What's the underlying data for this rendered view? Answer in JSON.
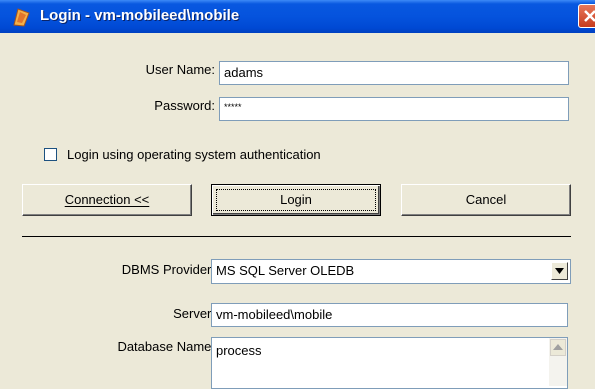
{
  "window": {
    "title": "Login - vm-mobileed\\mobile"
  },
  "login": {
    "username_label": "User Name:",
    "username_value": "adams",
    "password_label": "Password:",
    "password_value": "*****",
    "os_auth_label": "Login using operating system authentication",
    "os_auth_checked": false
  },
  "buttons": {
    "connection_label": "Connection <<",
    "login_label": "Login",
    "cancel_label": "Cancel"
  },
  "connection": {
    "provider_label": "DBMS Provider:",
    "provider_value": "MS SQL Server OLEDB",
    "server_label": "Server:",
    "server_value": "vm-mobileed\\mobile",
    "database_label": "Database Name:",
    "database_value": "process"
  },
  "icons": {
    "app": "login-app-icon",
    "close": "close-icon",
    "dropdown": "chevron-down-icon",
    "scroll_up": "scroll-up-arrow-icon"
  },
  "colors": {
    "titlebar": "#0553dd",
    "close_button": "#d9502f",
    "dialog_bg": "#ece9d8"
  }
}
